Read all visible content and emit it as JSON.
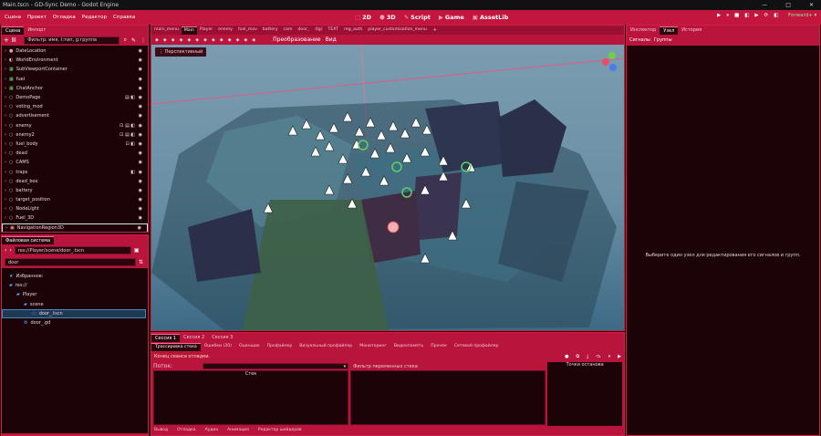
{
  "window": {
    "title": "Main.tscn - GD-Sync Demo - Godot Engine",
    "controls": [
      "—",
      "□",
      "✕"
    ]
  },
  "menus": [
    "Сцена",
    "Проект",
    "Отладка",
    "Редактор",
    "Справка"
  ],
  "workspaces": [
    {
      "icon": "⬚",
      "label": "2D"
    },
    {
      "icon": "⬢",
      "label": "3D"
    },
    {
      "icon": "✎",
      "label": "Script"
    },
    {
      "icon": "▶",
      "label": "Game"
    },
    {
      "icon": "▣",
      "label": "AssetLib"
    }
  ],
  "run_buttons": [
    "▶",
    "⏸",
    "■",
    "◧",
    "▶",
    "⟳",
    "◧"
  ],
  "renderer": "Forward+ ▾",
  "scene_dock": {
    "tabs": [
      "Сцена",
      "Импорт"
    ],
    "filter_placeholder": "Фильтр: имя, t:тип, g:группа",
    "nodes": [
      {
        "label": "DateLocation",
        "color": "#f0a0a0",
        "icon": "●",
        "extra": ""
      },
      {
        "label": "WorldEnvironment",
        "color": "#f0b0b0",
        "icon": "◐",
        "extra": ""
      },
      {
        "label": "SubViewportContainer",
        "color": "#6ee07a",
        "icon": "▦",
        "extra": ""
      },
      {
        "label": "fuel",
        "color": "#6ee07a",
        "icon": "▦",
        "extra": ""
      },
      {
        "label": "ChatAnchor",
        "color": "#6ee07a",
        "icon": "▦",
        "extra": ""
      },
      {
        "label": "DemoPage",
        "color": "#f0a0a0",
        "icon": "○",
        "extra": "▤ ◧"
      },
      {
        "label": "voting_mod",
        "color": "#f0a0a0",
        "icon": "○",
        "extra": ""
      },
      {
        "label": "advertisement",
        "color": "#f0a0a0",
        "icon": "○",
        "extra": ""
      },
      {
        "label": "enemy",
        "color": "#f0a0a0",
        "icon": "○",
        "extra": "⊡ ▤ ◧"
      },
      {
        "label": "enemy2",
        "color": "#f0a0a0",
        "icon": "○",
        "extra": "⊡ ▤ ◧"
      },
      {
        "label": "fuel_body",
        "color": "#f0a0a0",
        "icon": "○",
        "extra": "⊡ ◧"
      },
      {
        "label": "dead",
        "color": "#f0a0a0",
        "icon": "○",
        "extra": ""
      },
      {
        "label": "CAMS",
        "color": "#f0a0a0",
        "icon": "○",
        "extra": ""
      },
      {
        "label": "traps",
        "color": "#f0a0a0",
        "icon": "○",
        "extra": "◧"
      },
      {
        "label": "dead_box",
        "color": "#f0a0a0",
        "icon": "○",
        "extra": ""
      },
      {
        "label": "battery",
        "color": "#f0a0a0",
        "icon": "○",
        "extra": ""
      },
      {
        "label": "target_position",
        "color": "#f0a0a0",
        "icon": "○",
        "extra": ""
      },
      {
        "label": "NodeLight",
        "color": "#f0a0a0",
        "icon": "○",
        "extra": ""
      },
      {
        "label": "Fuel_3D",
        "color": "#f0a0a0",
        "icon": "○",
        "extra": ""
      },
      {
        "label": "NavigationRegion3D",
        "color": "#f0a0a0",
        "icon": "▣",
        "extra": ""
      }
    ]
  },
  "fs_dock": {
    "title": "Файловая система",
    "path": "res://Player/scene/door_.tscn",
    "search": "door",
    "items": [
      {
        "label": "Избранное:",
        "icon": "★",
        "indent": 0
      },
      {
        "label": "res://",
        "icon": "▰",
        "indent": 0
      },
      {
        "label": "Player",
        "icon": "▰",
        "indent": 1
      },
      {
        "label": "scene",
        "icon": "▰",
        "indent": 2
      },
      {
        "label": "door_.tscn",
        "icon": "▭",
        "indent": 3
      },
      {
        "label": "door_.gd",
        "icon": "⚙",
        "indent": 2
      }
    ]
  },
  "scene_tabs": [
    "main_menu",
    "Main",
    "Player",
    "enemy",
    "fuel_mov",
    "battery",
    "cam",
    "door_",
    "(tg)",
    "TEXT",
    "reg_auth",
    "player_customization_menu"
  ],
  "viewport_menu": [
    "Преобразование",
    "Вид"
  ],
  "viewport_label": "Перспективный",
  "bottom": {
    "sessions": [
      "Сессия 1",
      "Сессия 2",
      "Сессия 3"
    ],
    "tabs": [
      "Трассировка стека",
      "Ошибки (20)",
      "Оценщик",
      "Профайлер",
      "Визуальный профайлер",
      "Мониторинг",
      "Видеопамять",
      "Прочее",
      "Сетевой профайлер"
    ],
    "status": "Конец сеанса отладки.",
    "threads_label": "Поток:",
    "stack_header": "Стек",
    "filter_placeholder": "Фильтр переменных стека",
    "breakpoints": "Точки останова",
    "footer": [
      "Вывод",
      "Отладка",
      "Аудио",
      "Анимация",
      "Редактор шейдеров"
    ]
  },
  "inspector": {
    "tabs": [
      "Инспектор",
      "Узел",
      "История"
    ],
    "sub_tabs": [
      "Сигналы",
      "Группы"
    ],
    "message": "Выберите один узел для редактирования его сигналов и групп."
  },
  "colors": {
    "accent": "#c2163f",
    "panel_dark": "#1b0307",
    "viewport_sky": "#7a9bb0"
  }
}
